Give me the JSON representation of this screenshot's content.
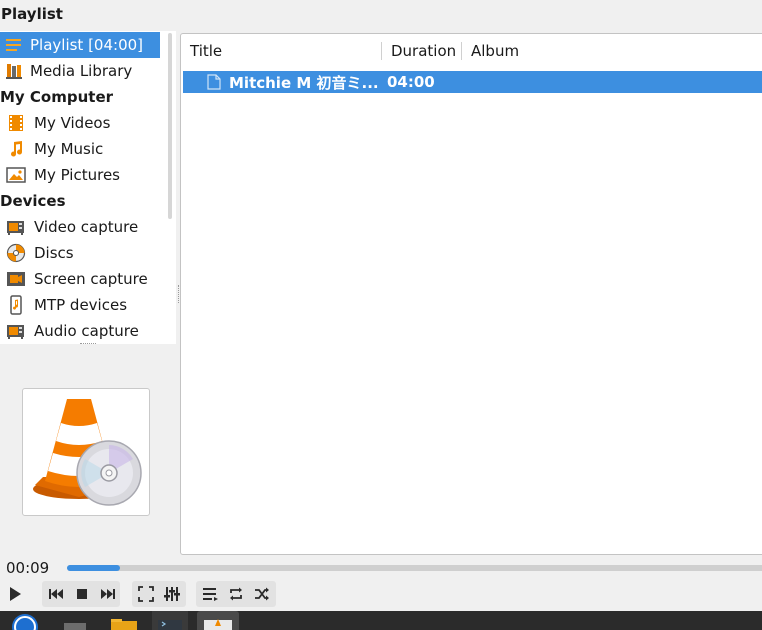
{
  "window": {
    "title": "Playlist"
  },
  "sidebar": {
    "items": [
      {
        "label": "Playlist [04:00]",
        "icon": "playlist-icon",
        "selected": true
      },
      {
        "label": "Media Library",
        "icon": "media-library-icon"
      }
    ],
    "my_computer": {
      "header": "My Computer",
      "items": [
        {
          "label": "My Videos",
          "icon": "film-icon"
        },
        {
          "label": "My Music",
          "icon": "music-note-icon"
        },
        {
          "label": "My Pictures",
          "icon": "picture-icon"
        }
      ]
    },
    "devices": {
      "header": "Devices",
      "items": [
        {
          "label": "Video capture",
          "icon": "capture-card-icon"
        },
        {
          "label": "Discs",
          "icon": "disc-icon"
        },
        {
          "label": "Screen capture",
          "icon": "camera-icon"
        },
        {
          "label": "MTP devices",
          "icon": "mtp-device-icon"
        },
        {
          "label": "Audio capture",
          "icon": "capture-card-icon"
        }
      ]
    }
  },
  "playlist": {
    "columns": [
      "Title",
      "Duration",
      "Album"
    ],
    "rows": [
      {
        "title": "Mitchie M 初音ミ...",
        "duration": "04:00",
        "album": ""
      }
    ]
  },
  "player": {
    "elapsed": "00:09",
    "progress_fraction": 0.075
  },
  "colors": {
    "accent": "#3d8fe0",
    "orange": "#f08a00"
  }
}
